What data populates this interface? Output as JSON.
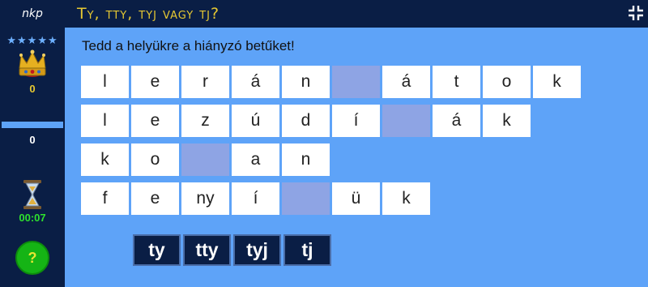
{
  "header": {
    "logo": "nkp",
    "title": "Ty, tty, tyj vagy tj?"
  },
  "sidebar": {
    "stars": "★★★★★",
    "score": "0",
    "progress_fraction": 0,
    "progress_value": "0",
    "timer": "00:07",
    "help_label": "?"
  },
  "instruction": "Tedd a helyükre a hiányzó betűket!",
  "rows": [
    [
      "l",
      "e",
      "r",
      "á",
      "n",
      "",
      "á",
      "t",
      "o",
      "k"
    ],
    [
      "l",
      "e",
      "z",
      "ú",
      "d",
      "í",
      "",
      "á",
      "k"
    ],
    [
      "k",
      "o",
      "",
      "a",
      "n"
    ],
    [
      "f",
      "e",
      "ny",
      "í",
      "",
      "ü",
      "k"
    ]
  ],
  "options": [
    "ty",
    "tty",
    "tyj",
    "tj"
  ],
  "colors": {
    "background": "#5ea3f8",
    "dark": "#0a1e45",
    "title": "#e6c832",
    "blank": "#8ea4e4",
    "timer": "#2ee02e"
  }
}
